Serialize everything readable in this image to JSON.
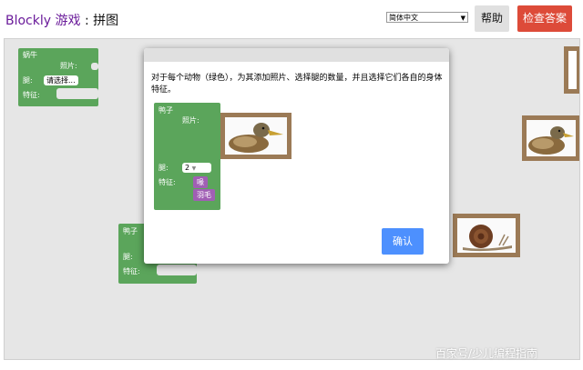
{
  "header": {
    "brand": "Blockly 游戏",
    "separator": " : ",
    "page": "拼图",
    "language": "简体中文",
    "help_label": "帮助",
    "check_label": "检查答案"
  },
  "workspace": {
    "snail_block": {
      "name": "蜗牛",
      "photo_label": "照片:",
      "legs_label": "腿:",
      "legs_value": "请选择...",
      "traits_label": "特征:"
    },
    "duck_block": {
      "name": "鸭子",
      "legs_label": "腿:",
      "traits_label": "特征:"
    }
  },
  "modal": {
    "instruction": "对于每个动物（绿色），为其添加照片、选择腿的数量，并且选择它们各自的身体特征。",
    "example": {
      "name": "鸭子",
      "photo_label": "照片:",
      "legs_label": "腿:",
      "legs_value": "2",
      "traits_label": "特征:",
      "trait_1": "喙",
      "trait_2": "羽毛"
    },
    "ok_label": "确认"
  },
  "watermark": "百家号/少儿编程指南",
  "colors": {
    "animal_block": "#5ba55b",
    "trait_block": "#a05fb4",
    "photo_frame": "#9b7a56",
    "check_button": "#dd4b39",
    "ok_button": "#4d90fe",
    "brand_text": "#6a1b9a"
  }
}
